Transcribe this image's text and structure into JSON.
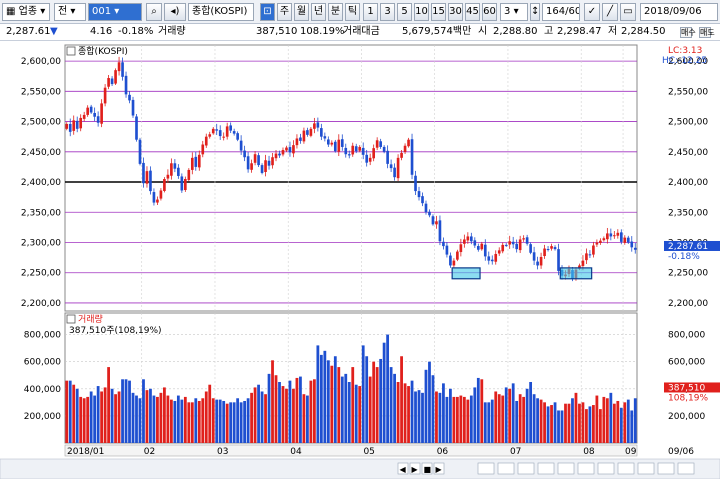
{
  "toolbar": {
    "market": "업종",
    "jeon": "전",
    "code": "001",
    "name": "종합(KOSPI)",
    "periods": [
      "주",
      "월",
      "년",
      "분",
      "틱"
    ],
    "intervals": [
      "1",
      "3",
      "5",
      "10",
      "15",
      "30",
      "45",
      "60"
    ],
    "interval_select": "3",
    "count": "164/600",
    "date": "2018/09/06",
    "buy_button": "매수",
    "sell_button": "매도"
  },
  "info": {
    "price": "2,287.61",
    "direction": "▼",
    "change": "4.16",
    "change_pct": "-0.18%",
    "volume_label": "거래량",
    "volume": "387,510",
    "volume_pct": "108.19%",
    "amount_label": "거래대금",
    "amount": "5,679,574백만",
    "open_label": "시",
    "open": "2,288.80",
    "high_label": "고",
    "high": "2,298.47",
    "low_label": "저",
    "low": "2,284.50"
  },
  "colors": {
    "up": "#e0201c",
    "down": "#1e4fd0",
    "grid_purple": "#a030c0",
    "highlight": "#40c8e8"
  },
  "chart_data": [
    {
      "type": "candlestick",
      "title": "종합(KOSPI)",
      "lc": "LC:3.13",
      "hc": "HC:-12.25",
      "y_ticks": [
        "2,600,00",
        "2,550,00",
        "2,500,00",
        "2,450,00",
        "2,400,00",
        "2,350,00",
        "2,300,00",
        "2,250,00",
        "2,200,00"
      ],
      "y_ticks_right": [
        "2,600,00",
        "2,550,00",
        "2,500,00",
        "2,450,00",
        "2,400,00",
        "2,350,00",
        "2,300,00",
        "2,250,00",
        "2,200,00"
      ],
      "ylim": [
        2190,
        2620
      ],
      "reference_line": 2400,
      "current_price": "2,287.61",
      "current_change": "-0.18%",
      "month_labels": [
        "2018/01",
        "02",
        "03",
        "04",
        "05",
        "06",
        "07",
        "08",
        "09",
        "09/06"
      ],
      "closes": [
        2496,
        2483,
        2502,
        2488,
        2506,
        2511,
        2523,
        2515,
        2508,
        2498,
        2530,
        2556,
        2572,
        2562,
        2585,
        2598,
        2574,
        2545,
        2535,
        2510,
        2470,
        2430,
        2398,
        2418,
        2385,
        2366,
        2371,
        2386,
        2405,
        2412,
        2431,
        2422,
        2410,
        2386,
        2405,
        2420,
        2440,
        2425,
        2445,
        2462,
        2475,
        2479,
        2488,
        2485,
        2476,
        2475,
        2492,
        2485,
        2480,
        2470,
        2452,
        2441,
        2421,
        2431,
        2446,
        2428,
        2415,
        2436,
        2427,
        2441,
        2447,
        2444,
        2453,
        2457,
        2449,
        2461,
        2472,
        2468,
        2485,
        2478,
        2488,
        2497,
        2490,
        2475,
        2472,
        2462,
        2465,
        2451,
        2470,
        2458,
        2446,
        2444,
        2460,
        2451,
        2458,
        2445,
        2432,
        2440,
        2456,
        2469,
        2458,
        2450,
        2430,
        2423,
        2408,
        2440,
        2448,
        2460,
        2470,
        2412,
        2385,
        2375,
        2365,
        2350,
        2345,
        2330,
        2335,
        2302,
        2294,
        2280,
        2262,
        2270,
        2285,
        2297,
        2305,
        2310,
        2302,
        2295,
        2288,
        2298,
        2277,
        2270,
        2269,
        2281,
        2287,
        2296,
        2295,
        2302,
        2297,
        2289,
        2305,
        2307,
        2298,
        2283,
        2270,
        2262,
        2276,
        2290,
        2289,
        2294,
        2289,
        2253,
        2245,
        2247,
        2256,
        2240,
        2255,
        2262,
        2270,
        2282,
        2280,
        2295,
        2300,
        2303,
        2307,
        2315,
        2310,
        2312,
        2316,
        2301,
        2308,
        2300,
        2292,
        2288
      ],
      "highlight_boxes": [
        {
          "x_from": 111,
          "x_to": 119,
          "y_from": 2240,
          "y_to": 2258
        },
        {
          "x_from": 142,
          "x_to": 151,
          "y_from": 2240,
          "y_to": 2258
        }
      ]
    },
    {
      "type": "bar",
      "title": "거래량",
      "summary": "387,510주(108,19%)",
      "y_ticks": [
        "800,000",
        "600,000",
        "400,000",
        "200,000"
      ],
      "y_ticks_right": [
        "800,000",
        "600,000",
        "400,000",
        "200,000"
      ],
      "ylim": [
        0,
        900000
      ],
      "current_volume": "387,510",
      "current_pct": "108,19%",
      "values": [
        460000,
        460000,
        430000,
        400000,
        340000,
        330000,
        340000,
        380000,
        350000,
        420000,
        380000,
        410000,
        560000,
        400000,
        360000,
        380000,
        470000,
        470000,
        460000,
        370000,
        350000,
        330000,
        470000,
        390000,
        400000,
        350000,
        340000,
        370000,
        410000,
        350000,
        320000,
        310000,
        350000,
        320000,
        340000,
        300000,
        300000,
        330000,
        310000,
        330000,
        380000,
        430000,
        330000,
        320000,
        320000,
        310000,
        290000,
        300000,
        300000,
        330000,
        300000,
        310000,
        330000,
        370000,
        410000,
        430000,
        380000,
        360000,
        510000,
        610000,
        500000,
        450000,
        420000,
        400000,
        460000,
        400000,
        480000,
        490000,
        360000,
        350000,
        460000,
        470000,
        720000,
        650000,
        680000,
        610000,
        570000,
        640000,
        560000,
        490000,
        510000,
        450000,
        560000,
        430000,
        420000,
        720000,
        640000,
        490000,
        600000,
        560000,
        620000,
        740000,
        800000,
        560000,
        510000,
        450000,
        640000,
        440000,
        420000,
        460000,
        380000,
        390000,
        370000,
        540000,
        600000,
        500000,
        380000,
        370000,
        440000,
        340000,
        400000,
        340000,
        340000,
        350000,
        340000,
        320000,
        350000,
        410000,
        480000,
        470000,
        300000,
        300000,
        320000,
        380000,
        360000,
        350000,
        410000,
        400000,
        440000,
        310000,
        360000,
        340000,
        400000,
        450000,
        360000,
        330000,
        320000,
        300000,
        270000,
        280000,
        300000,
        240000,
        240000,
        290000,
        290000,
        330000,
        370000,
        290000,
        300000,
        250000,
        270000,
        280000,
        350000,
        250000,
        340000,
        330000,
        370000,
        290000,
        310000,
        260000,
        300000,
        320000,
        240000,
        330000
      ]
    }
  ],
  "bottom_controls": [
    "◀",
    "▶",
    "■",
    "▶"
  ]
}
